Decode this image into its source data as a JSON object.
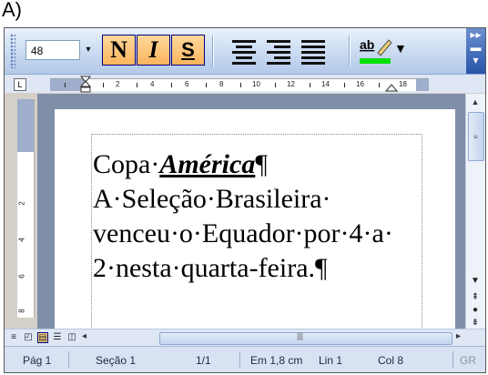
{
  "figure_label": "A)",
  "toolbar": {
    "font_size": "48",
    "bold_label": "N",
    "italic_label": "I",
    "shadow_label": "S",
    "highlight_letters": "ab",
    "highlight_color": "#00e000"
  },
  "ruler": {
    "tab_selector": "L",
    "labels": [
      "2",
      "4",
      "6",
      "8",
      "10",
      "12",
      "14",
      "16",
      "18"
    ],
    "vertical_labels": [
      "2",
      "4",
      "6",
      "8"
    ]
  },
  "document": {
    "line1_prefix": "Copa·",
    "line1_emph": "América",
    "line1_mark": "¶",
    "line2": "A·Seleção·Brasileira·",
    "line3": "venceu·o·Equador·por·4·a·",
    "line4_text": "2·nesta·quarta-feira.",
    "line4_mark": "¶"
  },
  "status": {
    "page": "Pág 1",
    "section": "Seção 1",
    "page_of": "1/1",
    "position": "Em 1,8 cm",
    "line": "Lin 1",
    "column": "Col 8",
    "gr": "GR"
  },
  "colors": {
    "toolbar_active": "#fbb45e",
    "doc_background": "#808fa8"
  }
}
